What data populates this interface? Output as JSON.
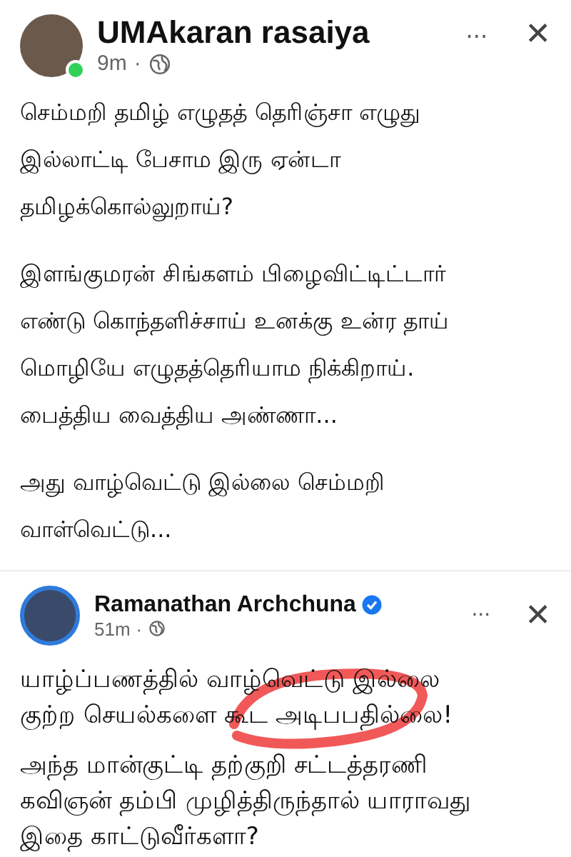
{
  "post": {
    "author": "UMAkaran rasaiya",
    "online": true,
    "time": "9m",
    "separator": "·",
    "more": "···",
    "close": "✕",
    "paragraphs": [
      [
        "செம்மறி தமிழ் எழுதத் தெரிஞ்சா எழுது",
        "இல்லாட்டி பேசாம இரு ஏன்டா",
        "தமிழக்கொல்லுறாய்?"
      ],
      [
        "இளங்குமரன் சிங்களம் பிழைவிட்டிட்டார்",
        "எண்டு கொந்தளிச்சாய் உனக்கு உன்ர தாய்",
        "மொழியே எழுதத்தெரியாம நிக்கிறாய்.",
        "பைத்திய வைத்திய அண்ணா..."
      ],
      [
        "அது வாழ்வெட்டு இல்லை செம்மறி",
        "வாள்வெட்டு..."
      ]
    ]
  },
  "shared_post": {
    "author": "Ramanathan Archchuna",
    "verified": true,
    "time": "51m",
    "separator": "·",
    "more": "···",
    "close": "✕",
    "scribble": true,
    "paragraphs": [
      [
        "யாழ்ப்பணத்தில் வாழ்வெட்டு இல்லை",
        "குற்ற செயல்களை கூட அடிபபதில்லை!"
      ],
      [
        "அந்த மான்குட்டி தற்குறி சட்டத்தரணி",
        "கவிஞன்  தம்பி முழித்திருந்தால் யாராவது",
        "இதை காட்டுவீர்களா?"
      ]
    ]
  }
}
